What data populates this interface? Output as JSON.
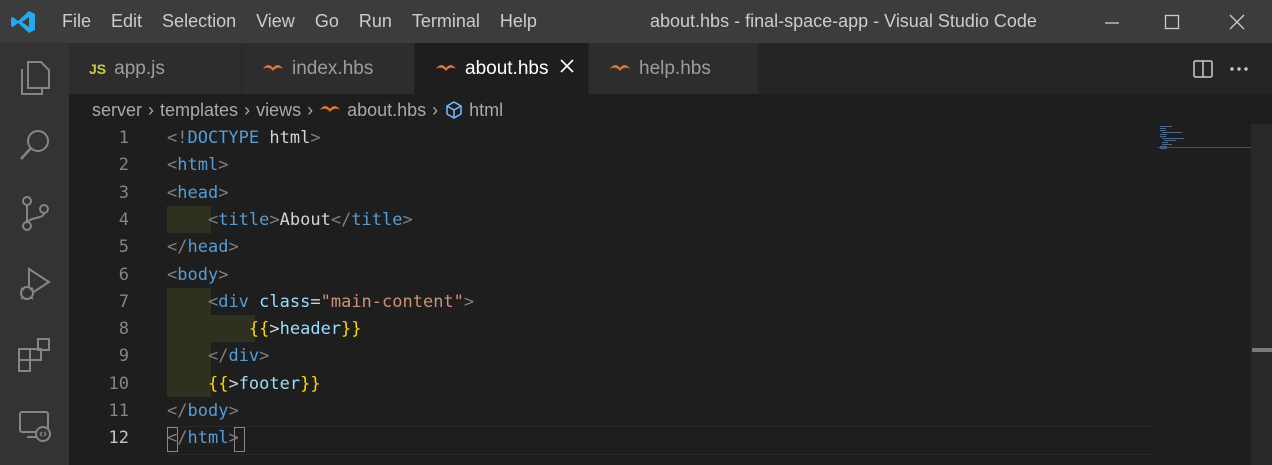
{
  "window": {
    "title": "about.hbs - final-space-app - Visual Studio Code",
    "menu": [
      "File",
      "Edit",
      "Selection",
      "View",
      "Go",
      "Run",
      "Terminal",
      "Help"
    ]
  },
  "tabs": [
    {
      "icon": "JS",
      "label": "app.js",
      "active": false
    },
    {
      "icon": "hbs-icon",
      "label": "index.hbs",
      "active": false
    },
    {
      "icon": "hbs-icon",
      "label": "about.hbs",
      "active": true
    },
    {
      "icon": "hbs-icon",
      "label": "help.hbs",
      "active": false
    }
  ],
  "breadcrumb": [
    "server",
    "templates",
    "views",
    "about.hbs",
    "html"
  ],
  "editor": {
    "current_line": 12,
    "lines": [
      {
        "n": "1",
        "tokens": [
          [
            "p",
            "<!"
          ],
          [
            "tag",
            "DOCTYPE"
          ],
          [
            "txt",
            " html"
          ],
          [
            "p",
            ">"
          ]
        ]
      },
      {
        "n": "2",
        "tokens": [
          [
            "p",
            "<"
          ],
          [
            "tag",
            "html"
          ],
          [
            "p",
            ">"
          ]
        ]
      },
      {
        "n": "3",
        "tokens": [
          [
            "p",
            "<"
          ],
          [
            "tag",
            "head"
          ],
          [
            "p",
            ">"
          ]
        ]
      },
      {
        "n": "4",
        "tokens": [
          [
            "txt",
            "    "
          ],
          [
            "p",
            "<"
          ],
          [
            "tag",
            "title"
          ],
          [
            "p",
            ">"
          ],
          [
            "txt",
            "About"
          ],
          [
            "p",
            "</"
          ],
          [
            "tag",
            "title"
          ],
          [
            "p",
            ">"
          ]
        ]
      },
      {
        "n": "5",
        "tokens": [
          [
            "p",
            "</"
          ],
          [
            "tag",
            "head"
          ],
          [
            "p",
            ">"
          ]
        ]
      },
      {
        "n": "6",
        "tokens": [
          [
            "p",
            "<"
          ],
          [
            "tag",
            "body"
          ],
          [
            "p",
            ">"
          ]
        ]
      },
      {
        "n": "7",
        "tokens": [
          [
            "txt",
            "    "
          ],
          [
            "p",
            "<"
          ],
          [
            "tag",
            "div"
          ],
          [
            "txt",
            " "
          ],
          [
            "attr",
            "class"
          ],
          [
            "txt",
            "="
          ],
          [
            "str",
            "\"main-content\""
          ],
          [
            "p",
            ">"
          ]
        ]
      },
      {
        "n": "8",
        "tokens": [
          [
            "txt",
            "        "
          ],
          [
            "hb",
            "{{"
          ],
          [
            "txt",
            ">"
          ],
          [
            "hbn",
            "header"
          ],
          [
            "hb",
            "}}"
          ]
        ]
      },
      {
        "n": "9",
        "tokens": [
          [
            "txt",
            "    "
          ],
          [
            "p",
            "</"
          ],
          [
            "tag",
            "div"
          ],
          [
            "p",
            ">"
          ]
        ]
      },
      {
        "n": "10",
        "tokens": [
          [
            "txt",
            "    "
          ],
          [
            "hb",
            "{{"
          ],
          [
            "txt",
            ">"
          ],
          [
            "hbn",
            "footer"
          ],
          [
            "hb",
            "}}"
          ]
        ]
      },
      {
        "n": "11",
        "tokens": [
          [
            "p",
            "</"
          ],
          [
            "tag",
            "body"
          ],
          [
            "p",
            ">"
          ]
        ]
      },
      {
        "n": "12",
        "tokens": [
          [
            "p",
            "</"
          ],
          [
            "tag",
            "html"
          ],
          [
            "p",
            ">"
          ]
        ]
      }
    ]
  },
  "colors": {
    "accent": "#007acc",
    "hbs": "#e37933",
    "js": "#cbcb41"
  }
}
